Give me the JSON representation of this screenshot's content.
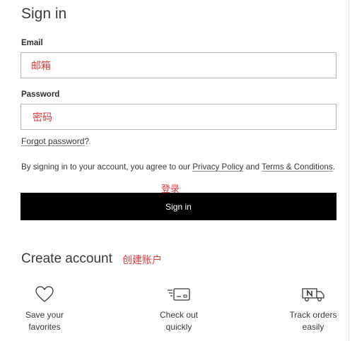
{
  "signin": {
    "title": "Sign in",
    "email_label": "Email",
    "email_annotation": "邮箱",
    "password_label": "Password",
    "password_annotation": "密码",
    "forgot_link": "Forgot password",
    "forgot_suffix": "?",
    "terms_prefix": "By signing in to your account, you agree to our ",
    "privacy_link": "Privacy Policy",
    "terms_and": " and ",
    "terms_link": "Terms & Conditions",
    "terms_suffix": ".",
    "button_annotation": "登录",
    "button_label": "Sign in"
  },
  "create": {
    "title": "Create account",
    "title_annotation": "创建账户",
    "benefits": [
      {
        "icon": "heart-icon",
        "text": "Save your\nfavorites"
      },
      {
        "icon": "card-icon",
        "text": "Check out\nquickly"
      },
      {
        "icon": "truck-icon",
        "text": "Track orders\neasily"
      }
    ]
  },
  "colors": {
    "annotation": "#e23b3b",
    "button_bg": "#000000",
    "text": "#393939"
  }
}
